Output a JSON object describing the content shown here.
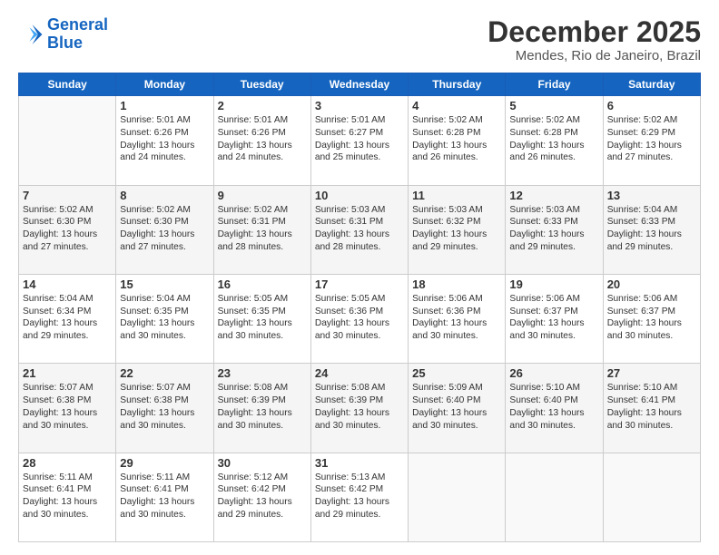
{
  "logo": {
    "line1": "General",
    "line2": "Blue"
  },
  "title": "December 2025",
  "subtitle": "Mendes, Rio de Janeiro, Brazil",
  "days": [
    "Sunday",
    "Monday",
    "Tuesday",
    "Wednesday",
    "Thursday",
    "Friday",
    "Saturday"
  ],
  "weeks": [
    [
      {
        "day": "",
        "sunrise": "",
        "sunset": "",
        "daylight": ""
      },
      {
        "day": "1",
        "sunrise": "Sunrise: 5:01 AM",
        "sunset": "Sunset: 6:26 PM",
        "daylight": "Daylight: 13 hours and 24 minutes."
      },
      {
        "day": "2",
        "sunrise": "Sunrise: 5:01 AM",
        "sunset": "Sunset: 6:26 PM",
        "daylight": "Daylight: 13 hours and 24 minutes."
      },
      {
        "day": "3",
        "sunrise": "Sunrise: 5:01 AM",
        "sunset": "Sunset: 6:27 PM",
        "daylight": "Daylight: 13 hours and 25 minutes."
      },
      {
        "day": "4",
        "sunrise": "Sunrise: 5:02 AM",
        "sunset": "Sunset: 6:28 PM",
        "daylight": "Daylight: 13 hours and 26 minutes."
      },
      {
        "day": "5",
        "sunrise": "Sunrise: 5:02 AM",
        "sunset": "Sunset: 6:28 PM",
        "daylight": "Daylight: 13 hours and 26 minutes."
      },
      {
        "day": "6",
        "sunrise": "Sunrise: 5:02 AM",
        "sunset": "Sunset: 6:29 PM",
        "daylight": "Daylight: 13 hours and 27 minutes."
      }
    ],
    [
      {
        "day": "7",
        "sunrise": "Sunrise: 5:02 AM",
        "sunset": "Sunset: 6:30 PM",
        "daylight": "Daylight: 13 hours and 27 minutes."
      },
      {
        "day": "8",
        "sunrise": "Sunrise: 5:02 AM",
        "sunset": "Sunset: 6:30 PM",
        "daylight": "Daylight: 13 hours and 27 minutes."
      },
      {
        "day": "9",
        "sunrise": "Sunrise: 5:02 AM",
        "sunset": "Sunset: 6:31 PM",
        "daylight": "Daylight: 13 hours and 28 minutes."
      },
      {
        "day": "10",
        "sunrise": "Sunrise: 5:03 AM",
        "sunset": "Sunset: 6:31 PM",
        "daylight": "Daylight: 13 hours and 28 minutes."
      },
      {
        "day": "11",
        "sunrise": "Sunrise: 5:03 AM",
        "sunset": "Sunset: 6:32 PM",
        "daylight": "Daylight: 13 hours and 29 minutes."
      },
      {
        "day": "12",
        "sunrise": "Sunrise: 5:03 AM",
        "sunset": "Sunset: 6:33 PM",
        "daylight": "Daylight: 13 hours and 29 minutes."
      },
      {
        "day": "13",
        "sunrise": "Sunrise: 5:04 AM",
        "sunset": "Sunset: 6:33 PM",
        "daylight": "Daylight: 13 hours and 29 minutes."
      }
    ],
    [
      {
        "day": "14",
        "sunrise": "Sunrise: 5:04 AM",
        "sunset": "Sunset: 6:34 PM",
        "daylight": "Daylight: 13 hours and 29 minutes."
      },
      {
        "day": "15",
        "sunrise": "Sunrise: 5:04 AM",
        "sunset": "Sunset: 6:35 PM",
        "daylight": "Daylight: 13 hours and 30 minutes."
      },
      {
        "day": "16",
        "sunrise": "Sunrise: 5:05 AM",
        "sunset": "Sunset: 6:35 PM",
        "daylight": "Daylight: 13 hours and 30 minutes."
      },
      {
        "day": "17",
        "sunrise": "Sunrise: 5:05 AM",
        "sunset": "Sunset: 6:36 PM",
        "daylight": "Daylight: 13 hours and 30 minutes."
      },
      {
        "day": "18",
        "sunrise": "Sunrise: 5:06 AM",
        "sunset": "Sunset: 6:36 PM",
        "daylight": "Daylight: 13 hours and 30 minutes."
      },
      {
        "day": "19",
        "sunrise": "Sunrise: 5:06 AM",
        "sunset": "Sunset: 6:37 PM",
        "daylight": "Daylight: 13 hours and 30 minutes."
      },
      {
        "day": "20",
        "sunrise": "Sunrise: 5:06 AM",
        "sunset": "Sunset: 6:37 PM",
        "daylight": "Daylight: 13 hours and 30 minutes."
      }
    ],
    [
      {
        "day": "21",
        "sunrise": "Sunrise: 5:07 AM",
        "sunset": "Sunset: 6:38 PM",
        "daylight": "Daylight: 13 hours and 30 minutes."
      },
      {
        "day": "22",
        "sunrise": "Sunrise: 5:07 AM",
        "sunset": "Sunset: 6:38 PM",
        "daylight": "Daylight: 13 hours and 30 minutes."
      },
      {
        "day": "23",
        "sunrise": "Sunrise: 5:08 AM",
        "sunset": "Sunset: 6:39 PM",
        "daylight": "Daylight: 13 hours and 30 minutes."
      },
      {
        "day": "24",
        "sunrise": "Sunrise: 5:08 AM",
        "sunset": "Sunset: 6:39 PM",
        "daylight": "Daylight: 13 hours and 30 minutes."
      },
      {
        "day": "25",
        "sunrise": "Sunrise: 5:09 AM",
        "sunset": "Sunset: 6:40 PM",
        "daylight": "Daylight: 13 hours and 30 minutes."
      },
      {
        "day": "26",
        "sunrise": "Sunrise: 5:10 AM",
        "sunset": "Sunset: 6:40 PM",
        "daylight": "Daylight: 13 hours and 30 minutes."
      },
      {
        "day": "27",
        "sunrise": "Sunrise: 5:10 AM",
        "sunset": "Sunset: 6:41 PM",
        "daylight": "Daylight: 13 hours and 30 minutes."
      }
    ],
    [
      {
        "day": "28",
        "sunrise": "Sunrise: 5:11 AM",
        "sunset": "Sunset: 6:41 PM",
        "daylight": "Daylight: 13 hours and 30 minutes."
      },
      {
        "day": "29",
        "sunrise": "Sunrise: 5:11 AM",
        "sunset": "Sunset: 6:41 PM",
        "daylight": "Daylight: 13 hours and 30 minutes."
      },
      {
        "day": "30",
        "sunrise": "Sunrise: 5:12 AM",
        "sunset": "Sunset: 6:42 PM",
        "daylight": "Daylight: 13 hours and 29 minutes."
      },
      {
        "day": "31",
        "sunrise": "Sunrise: 5:13 AM",
        "sunset": "Sunset: 6:42 PM",
        "daylight": "Daylight: 13 hours and 29 minutes."
      },
      {
        "day": "",
        "sunrise": "",
        "sunset": "",
        "daylight": ""
      },
      {
        "day": "",
        "sunrise": "",
        "sunset": "",
        "daylight": ""
      },
      {
        "day": "",
        "sunrise": "",
        "sunset": "",
        "daylight": ""
      }
    ]
  ]
}
